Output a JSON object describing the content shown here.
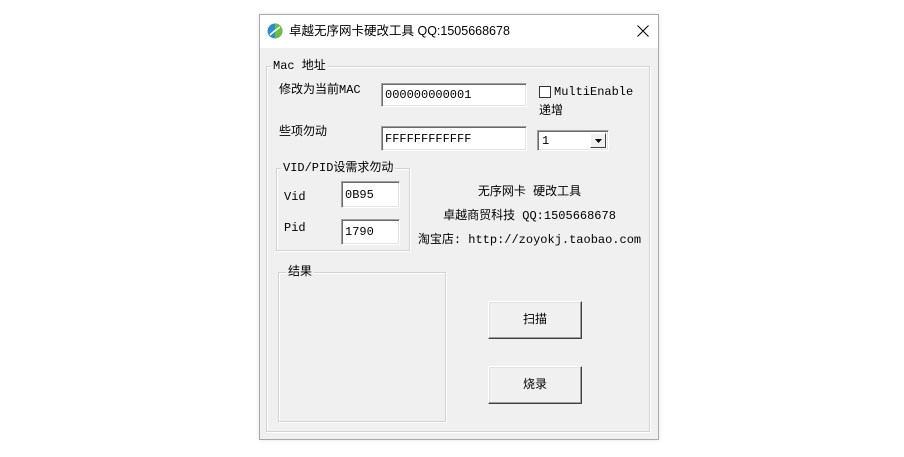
{
  "window": {
    "title": "卓越无序网卡硬改工具 QQ:1505668678"
  },
  "mac_group": {
    "legend": "Mac 地址",
    "current_mac_label": "修改为当前MAC",
    "current_mac_value": "000000000001",
    "multi_enable_label": "MultiEnable",
    "multi_enable_checked": false,
    "increment_label": "递增",
    "fixed_label": "些项勿动",
    "fixed_value": "FFFFFFFFFFFF",
    "increment_value": "1"
  },
  "vidpid_group": {
    "legend": "VID/PID设需求勿动",
    "vid_label": "Vid",
    "vid_value": "0B95",
    "pid_label": "Pid",
    "pid_value": "1790"
  },
  "info": {
    "line1": "无序网卡 硬改工具",
    "line2": "卓越商贸科技 QQ:1505668678",
    "line3": "淘宝店: http://zoyokj.taobao.com"
  },
  "result_group": {
    "legend": "结果"
  },
  "buttons": {
    "scan": "扫描",
    "burn": "烧录"
  },
  "icons": {
    "app": "app-icon",
    "close": "close-icon",
    "dropdown": "chevron-down-icon",
    "checkbox": "checkbox-unchecked-icon"
  },
  "colors": {
    "dialog_bg": "#f0f0f0",
    "titlebar_bg": "#ffffff"
  }
}
